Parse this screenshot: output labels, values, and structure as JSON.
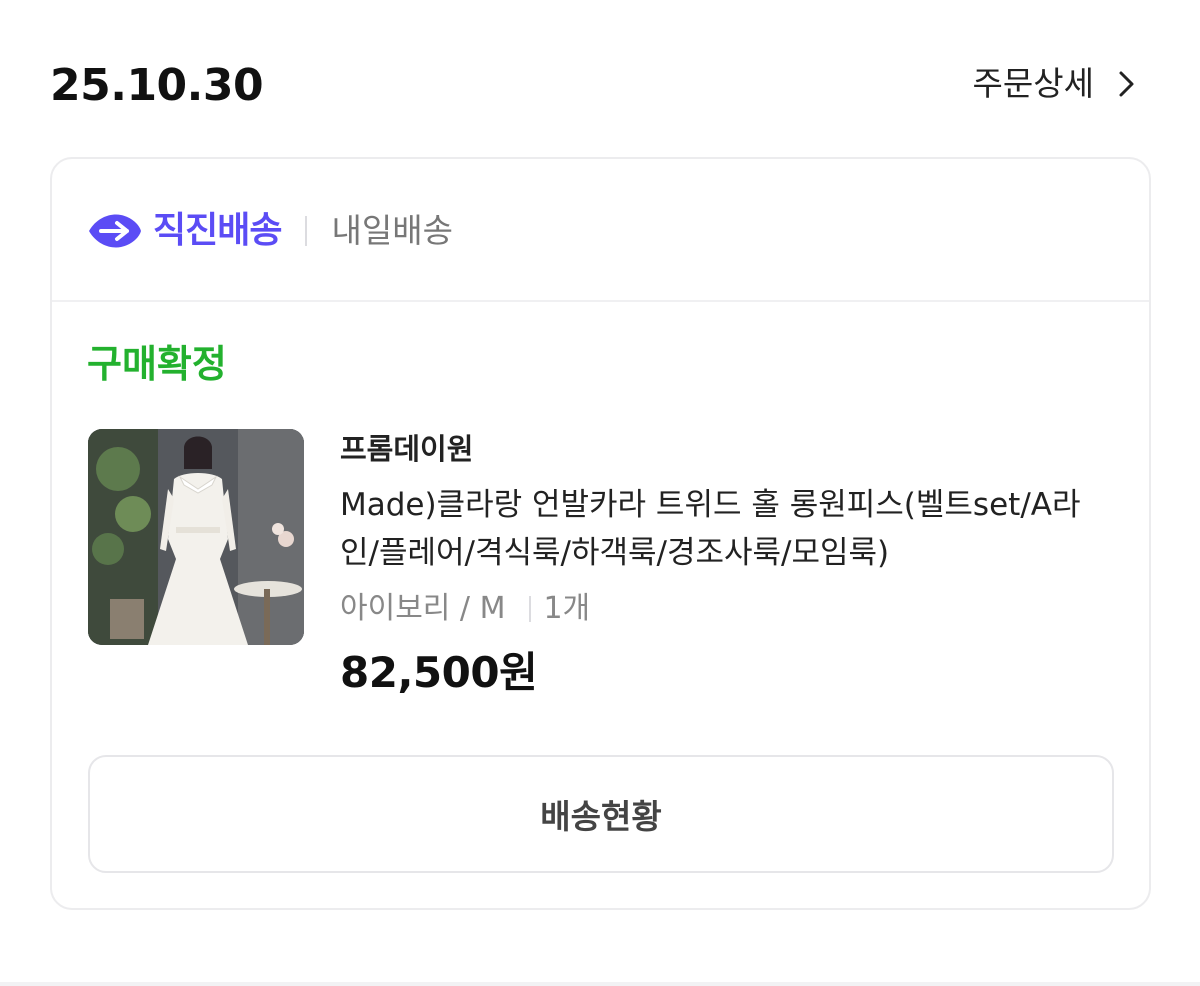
{
  "order": {
    "date": "25.10.30",
    "detail_label": "주문상세"
  },
  "delivery": {
    "brand": "직진배송",
    "sub": "내일배송",
    "brand_color": "#5b4cf5"
  },
  "status": {
    "label": "구매확정",
    "color": "#23b12e"
  },
  "product": {
    "seller": "프롬데이원",
    "title": "Made)클라랑 언발카라 트위드 홀 롱원피스(벨트set/A라인/플레어/격식룩/하객룩/경조사룩/모임룩)",
    "option": "아이보리 / M",
    "quantity": "1개",
    "price": "82,500원"
  },
  "actions": {
    "track_label": "배송현황"
  }
}
